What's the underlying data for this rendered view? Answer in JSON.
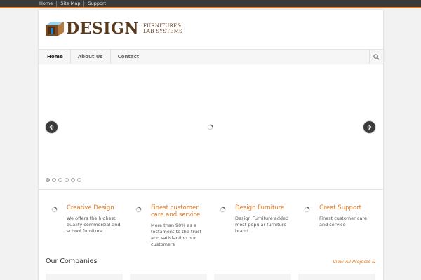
{
  "topbar": {
    "links": [
      "Home",
      "Site Map",
      "Support"
    ]
  },
  "brand": {
    "wordmark": "DESIGN",
    "tagline_line1": "FURNITURE&",
    "tagline_line2": "LAB SYSTEMS",
    "color": "#5a3a1c"
  },
  "nav": {
    "items": [
      "Home",
      "About Us",
      "Contact"
    ],
    "active": "Home",
    "search_icon": "search-icon"
  },
  "slider": {
    "prev_icon": "arrow-left-icon",
    "next_icon": "arrow-right-icon",
    "loader_icon": "loading-spinner-icon",
    "slide_count": 6,
    "active_slide": 1
  },
  "features": [
    {
      "title": "Creative Design",
      "text_lines": [
        "We offers the highest",
        "quality commercial and",
        "school furniture"
      ]
    },
    {
      "title_lines": [
        "Finest customer",
        "care and service"
      ],
      "text_lines": [
        "More than 90% as a",
        "testament to the trust",
        "and satisfaction our",
        "customers"
      ]
    },
    {
      "title": "Design Furniture",
      "text_lines": [
        "Design Furniture added",
        "most popular furniture",
        "brand."
      ]
    },
    {
      "title": "Great Support",
      "text_lines": [
        "Finest customer care",
        "and service"
      ]
    }
  ],
  "companies": {
    "title": "Our Companies",
    "view_all": "View All Projects &"
  },
  "colors": {
    "accent": "#e57a1f",
    "topbar": "#3a3a3a",
    "arrow": "#3b3b3b"
  }
}
